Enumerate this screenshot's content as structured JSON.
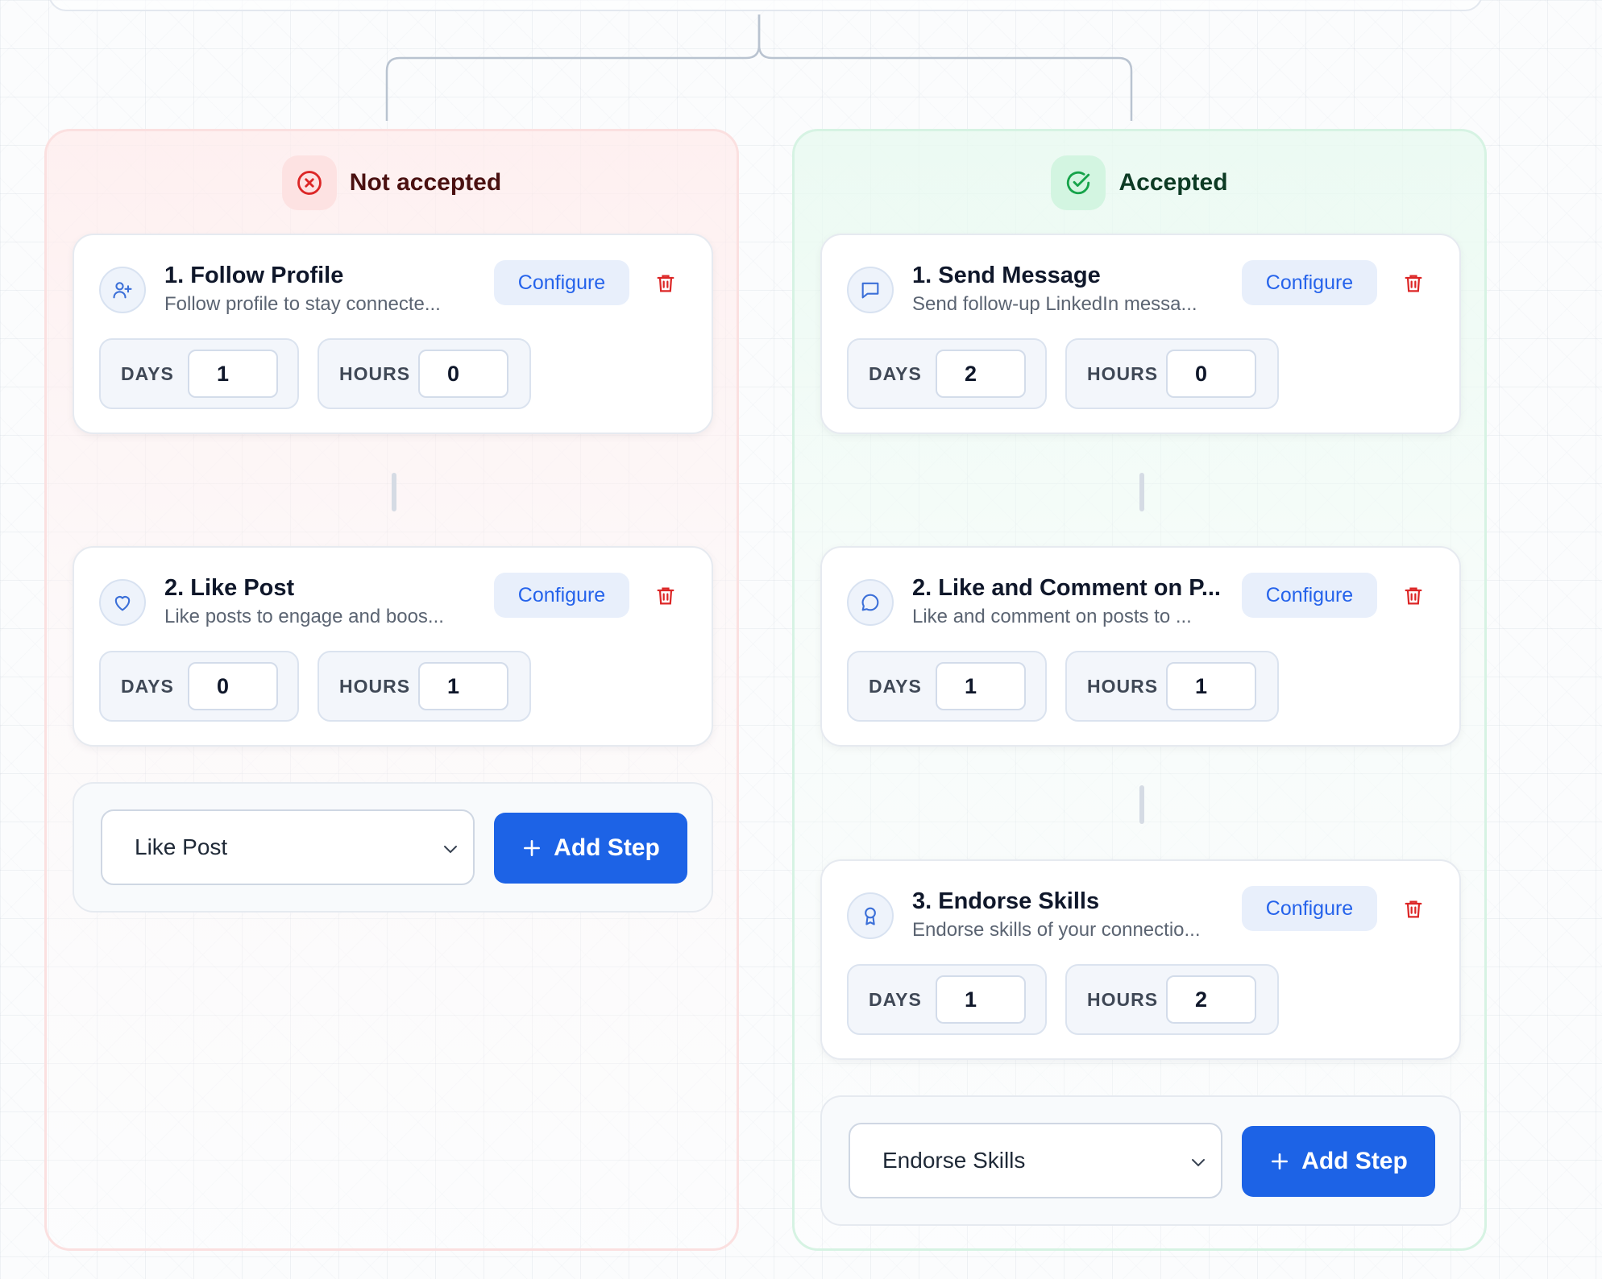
{
  "branches": {
    "not_accepted": {
      "title": "Not accepted",
      "steps": [
        {
          "title": "1. Follow Profile",
          "desc": "Follow profile to stay connecte...",
          "icon": "user-plus-icon",
          "configure_label": "Configure",
          "days_label": "DAYS",
          "hours_label": "HOURS",
          "days": "1",
          "hours": "0"
        },
        {
          "title": "2. Like Post",
          "desc": "Like posts to engage and boos...",
          "icon": "heart-icon",
          "configure_label": "Configure",
          "days_label": "DAYS",
          "hours_label": "HOURS",
          "days": "0",
          "hours": "1"
        }
      ],
      "add": {
        "selected": "Like Post",
        "button_label": "Add Step"
      }
    },
    "accepted": {
      "title": "Accepted",
      "steps": [
        {
          "title": "1. Send Message",
          "desc": "Send follow-up LinkedIn messa...",
          "icon": "message-square-icon",
          "configure_label": "Configure",
          "days_label": "DAYS",
          "hours_label": "HOURS",
          "days": "2",
          "hours": "0"
        },
        {
          "title": "2. Like and Comment on P...",
          "desc": "Like and comment on posts to ...",
          "icon": "message-circle-icon",
          "configure_label": "Configure",
          "days_label": "DAYS",
          "hours_label": "HOURS",
          "days": "1",
          "hours": "1"
        },
        {
          "title": "3. Endorse Skills",
          "desc": "Endorse skills of your connectio...",
          "icon": "award-icon",
          "configure_label": "Configure",
          "days_label": "DAYS",
          "hours_label": "HOURS",
          "days": "1",
          "hours": "2"
        }
      ],
      "add": {
        "selected": "Endorse Skills",
        "button_label": "Add Step"
      }
    }
  },
  "colors": {
    "accent": "#1d63e6",
    "configure_bg": "#e8effb",
    "delete": "#dc2626",
    "negative": "#dc2626",
    "positive": "#16a34a"
  }
}
